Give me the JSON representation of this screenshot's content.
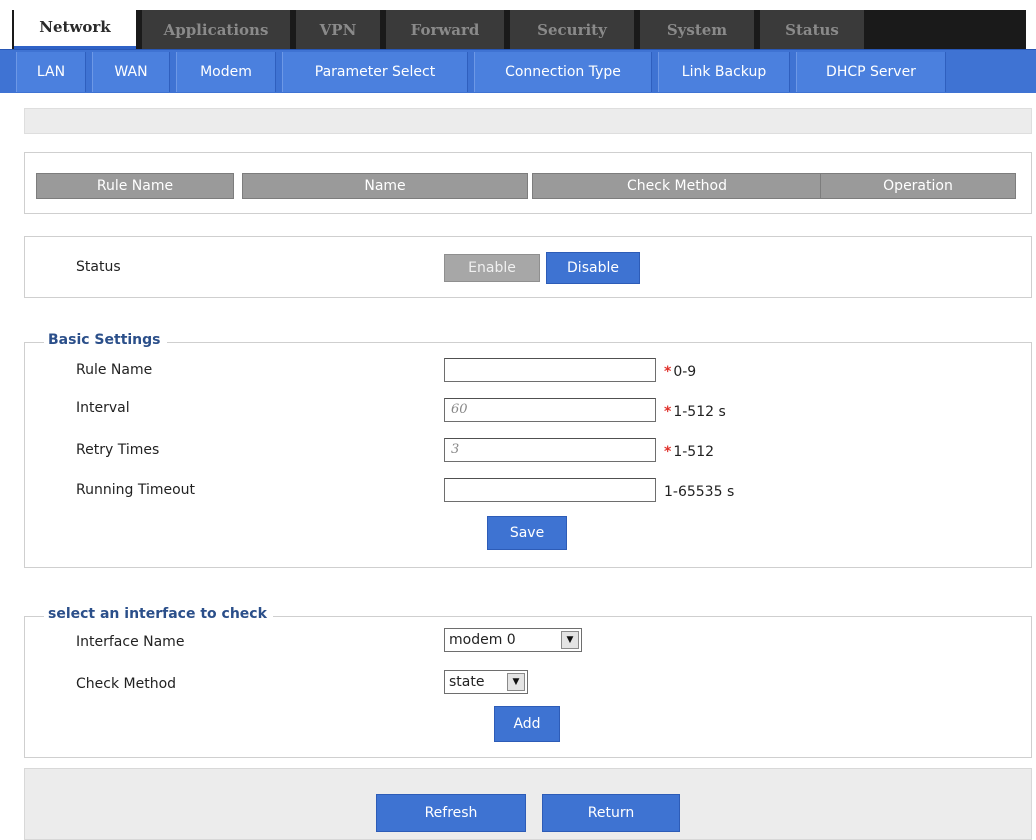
{
  "top_tabs": [
    {
      "label": "Network"
    },
    {
      "label": "Applications"
    },
    {
      "label": "VPN"
    },
    {
      "label": "Forward"
    },
    {
      "label": "Security"
    },
    {
      "label": "System"
    },
    {
      "label": "Status"
    }
  ],
  "active_top_tab": "Network",
  "sub_tabs": [
    {
      "label": "LAN"
    },
    {
      "label": "WAN"
    },
    {
      "label": "Modem"
    },
    {
      "label": "Parameter Select"
    },
    {
      "label": "Connection Type"
    },
    {
      "label": "Link Backup"
    },
    {
      "label": "DHCP Server"
    }
  ],
  "rules_table": {
    "columns": [
      "Rule Name",
      "Name",
      "Check Method",
      "Operation"
    ]
  },
  "status_section": {
    "label": "Status",
    "enable_label": "Enable",
    "disable_label": "Disable"
  },
  "basic_settings": {
    "legend": "Basic Settings",
    "rule_name": {
      "label": "Rule Name",
      "value": "",
      "hint": "0-9",
      "required": true
    },
    "interval": {
      "label": "Interval",
      "value": "60",
      "hint": "1-512 s",
      "required": true
    },
    "retry_times": {
      "label": "Retry Times",
      "value": "3",
      "hint": "1-512",
      "required": true
    },
    "running_timeout": {
      "label": "Running Timeout",
      "value": "",
      "hint": "1-65535 s",
      "required": false
    },
    "save_label": "Save"
  },
  "interface_check": {
    "legend": "select an interface to check",
    "interface_name": {
      "label": "Interface Name",
      "selected": "modem 0"
    },
    "check_method": {
      "label": "Check Method",
      "selected": "state"
    },
    "add_label": "Add"
  },
  "footer": {
    "refresh_label": "Refresh",
    "return_label": "Return"
  },
  "required_mark": "*",
  "colors": {
    "accent_blue": "#3e73d2",
    "tab_dark": "#1a1a1a",
    "legend_blue": "#2b4f8a",
    "required_red": "#e0302a"
  }
}
